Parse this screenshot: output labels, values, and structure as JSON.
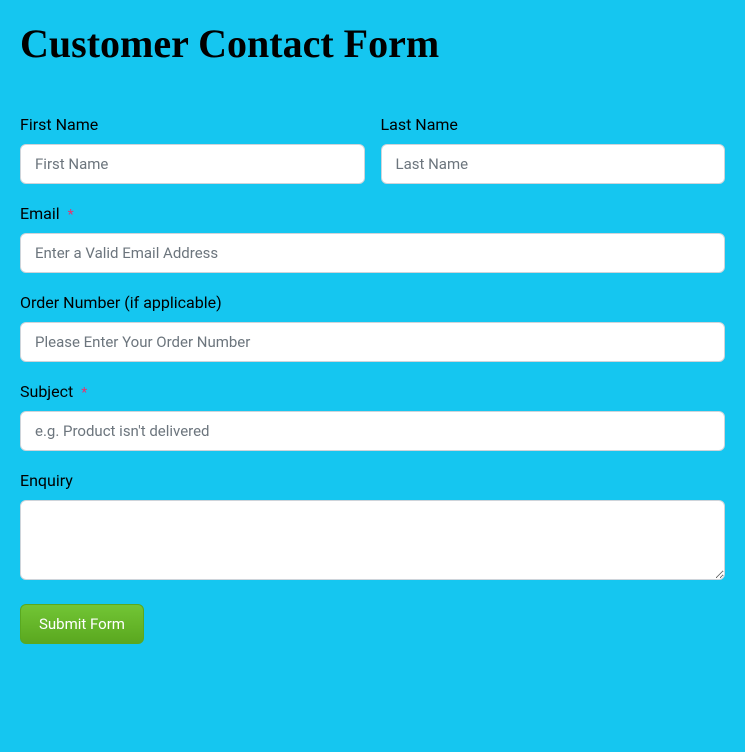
{
  "title": "Customer Contact Form",
  "fields": {
    "firstName": {
      "label": "First Name",
      "placeholder": "First Name",
      "value": ""
    },
    "lastName": {
      "label": "Last Name",
      "placeholder": "Last Name",
      "value": ""
    },
    "email": {
      "label": "Email",
      "placeholder": "Enter a Valid Email Address",
      "value": "",
      "required": true
    },
    "orderNumber": {
      "label": "Order Number (if applicable)",
      "placeholder": "Please Enter Your Order Number",
      "value": ""
    },
    "subject": {
      "label": "Subject",
      "placeholder": "e.g. Product isn't delivered",
      "value": "",
      "required": true
    },
    "enquiry": {
      "label": "Enquiry",
      "placeholder": "",
      "value": ""
    }
  },
  "submit": {
    "label": "Submit Form"
  },
  "requiredMark": "*"
}
